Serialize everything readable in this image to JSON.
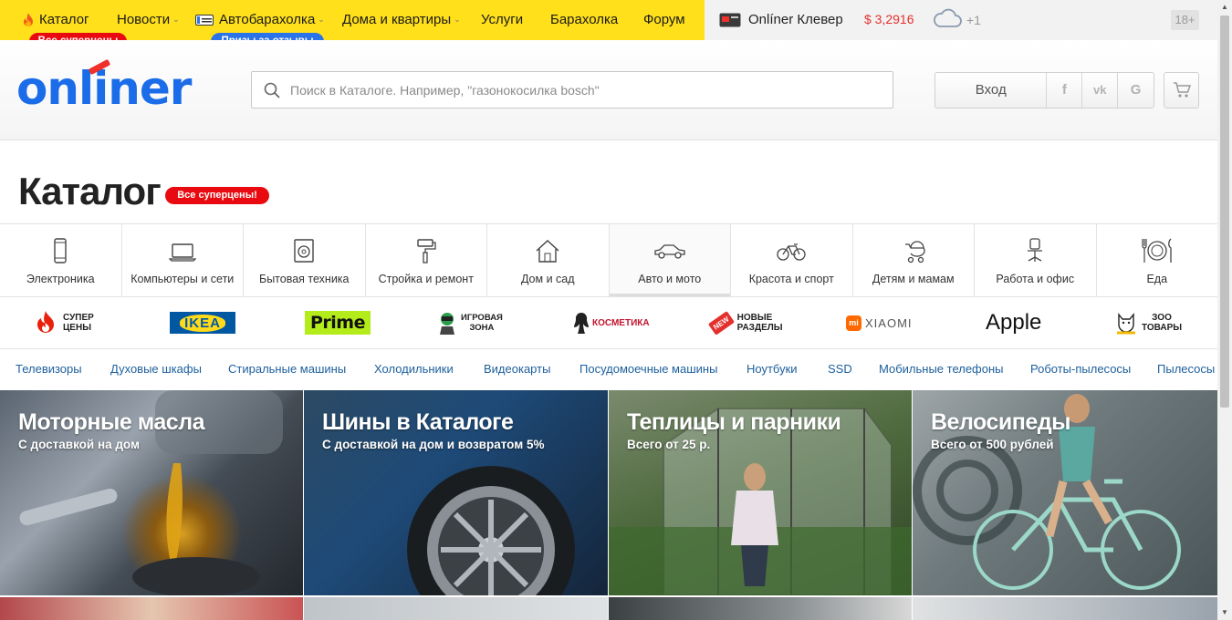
{
  "topnav": {
    "items": [
      {
        "label": "Каталог",
        "icon": "fire-icon"
      },
      {
        "label": "Новости",
        "dropdown": true
      },
      {
        "label": "Автобарахолка",
        "icon": "car-plate-icon",
        "dropdown": true
      },
      {
        "label": "Дома и квартиры",
        "dropdown": true
      },
      {
        "label": "Услуги"
      },
      {
        "label": "Барахолка"
      },
      {
        "label": "Форум"
      }
    ],
    "badges": [
      {
        "label": "Все суперцены",
        "color": "#e80a10"
      },
      {
        "label": "Призы за отзывы",
        "color": "#2a73e8"
      }
    ],
    "clever": "Onlíner Клевер",
    "currency": "$ 3,2916",
    "weather": "+1",
    "age": "18+",
    "colors": {
      "bar": "#ffe01b",
      "currency": "#e4302d"
    }
  },
  "header": {
    "logo": "onliner",
    "search_placeholder": "Поиск в Каталоге. Например, \"газонокосилка bosch\"",
    "login": "Вход",
    "socials": [
      "f",
      "vk",
      "G"
    ]
  },
  "page": {
    "title": "Каталог",
    "badge": "Все суперцены!"
  },
  "categories": [
    {
      "label": "Электроника",
      "icon": "smartphone-icon"
    },
    {
      "label": "Компьютеры и сети",
      "icon": "laptop-icon"
    },
    {
      "label": "Бытовая техника",
      "icon": "washing-machine-icon"
    },
    {
      "label": "Стройка и ремонт",
      "icon": "paint-roller-icon"
    },
    {
      "label": "Дом и сад",
      "icon": "house-icon"
    },
    {
      "label": "Авто и мото",
      "icon": "car-icon",
      "active": true
    },
    {
      "label": "Красота и спорт",
      "icon": "bicycle-icon"
    },
    {
      "label": "Детям и мамам",
      "icon": "stroller-icon"
    },
    {
      "label": "Работа и офис",
      "icon": "office-chair-icon"
    },
    {
      "label": "Еда",
      "icon": "plate-cutlery-icon"
    }
  ],
  "brands": {
    "super": [
      "СУПЕР",
      "ЦЕНЫ"
    ],
    "ikea": "IKEA",
    "prime": "Prime",
    "game": [
      "ИГРОВАЯ",
      "ЗОНА"
    ],
    "cosmetics": "КОСМЕТИКА",
    "new_badge": "NEW",
    "new": [
      "НОВЫЕ",
      "РАЗДЕЛЫ"
    ],
    "xiaomi_mark": "mi",
    "xiaomi": "XIAOMI",
    "apple": "Apple",
    "zoo": [
      "ЗОО",
      "ТОВАРЫ"
    ]
  },
  "quick_links": [
    "Телевизоры",
    "Духовые шкафы",
    "Стиральные машины",
    "Холодильники",
    "Видеокарты",
    "Посудомоечные машины",
    "Ноутбуки",
    "SSD",
    "Мобильные телефоны",
    "Роботы-пылесосы",
    "Пылесосы"
  ],
  "banners": [
    {
      "title": "Моторные масла",
      "subtitle": "С доставкой на дом"
    },
    {
      "title": "Шины в Каталоге",
      "subtitle": "С доставкой на дом и возвратом 5%"
    },
    {
      "title": "Теплицы и парники",
      "subtitle": "Всего от 25 р."
    },
    {
      "title": "Велосипеды",
      "subtitle": "Всего от 500 рублей"
    }
  ]
}
